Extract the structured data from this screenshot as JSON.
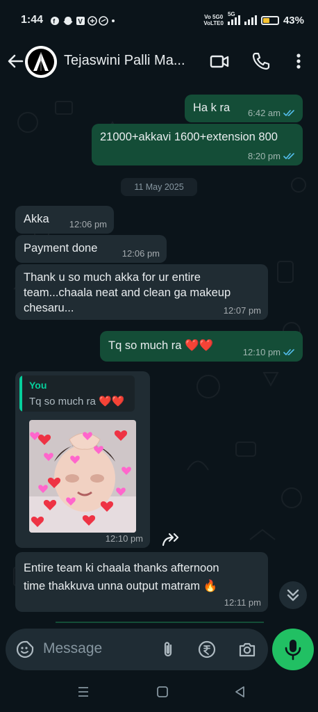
{
  "status_bar": {
    "time": "1:44",
    "network_top": "Vo 5G0",
    "network_bottom": "VoLTE0",
    "net_gen": "5G",
    "battery": "43%",
    "battery_level": 0.43
  },
  "header": {
    "contact_name": "Tejaswini Palli Ma...",
    "icons": [
      "back-arrow-icon",
      "video-call-icon",
      "phone-icon",
      "more-vertical-icon"
    ]
  },
  "messages": {
    "m1": {
      "text": "Ha k ra",
      "time": "6:42 am",
      "direction": "outgoing",
      "status": "read"
    },
    "m2": {
      "text": "21000+akkavi 1600+extension 800",
      "time": "8:20 pm",
      "direction": "outgoing",
      "status": "read"
    },
    "date_divider": "11 May 2025",
    "m3": {
      "text": "Akka",
      "time": "12:06 pm",
      "direction": "incoming"
    },
    "m4": {
      "text": "Payment done",
      "time": "12:06 pm",
      "direction": "incoming"
    },
    "m5": {
      "line1": "Thank u so much  akka for ur entire",
      "line2": "team...chaala neat and clean ga makeup",
      "line3": "chesaru...",
      "time": "12:07 pm",
      "direction": "incoming"
    },
    "m6": {
      "text": "Tq so much ra ❤️❤️",
      "time": "12:10 pm",
      "direction": "outgoing",
      "status": "read"
    },
    "m7": {
      "reply_author": "You",
      "reply_text": "Tq so much ra ❤️❤️",
      "sticker": "baby-heart-hands-sticker",
      "time": "12:10 pm",
      "direction": "incoming"
    },
    "m8": {
      "line1": "Entire team ki chaala thanks afternoon",
      "line2": "time thakkuva unna output matram 🔥",
      "time": "12:11 pm",
      "direction": "incoming"
    }
  },
  "composer": {
    "placeholder": "Message",
    "icons": [
      "sticker-icon",
      "attach-icon",
      "rupee-payment-icon",
      "camera-icon",
      "mic-icon"
    ]
  },
  "colors": {
    "background": "#0b141a",
    "outgoing_bubble": "#144d37",
    "incoming_bubble": "#202c33",
    "read_ticks": "#53bdeb",
    "accent_green": "#21c063",
    "reply_accent": "#06cf9c"
  }
}
